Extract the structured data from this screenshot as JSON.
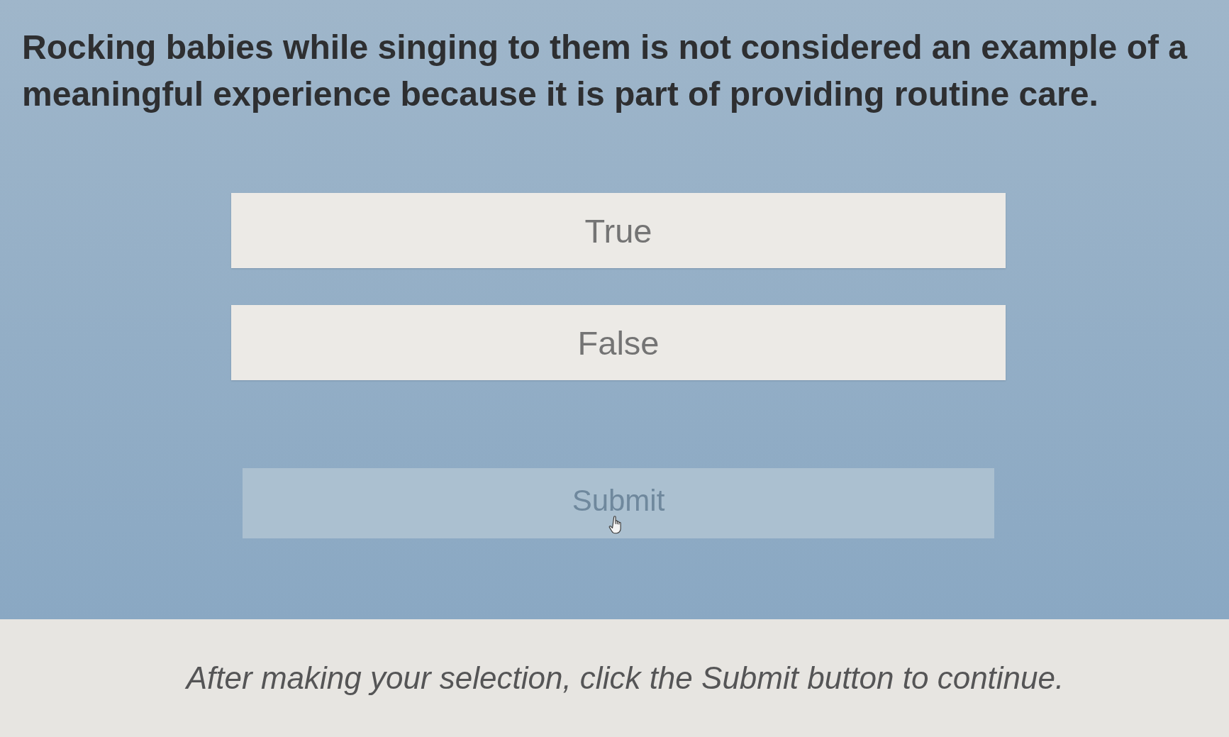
{
  "question": "Rocking babies while singing to them is not considered an example of a meaningful experience because it is part of providing routine care.",
  "options": [
    {
      "label": "True",
      "selected": false
    },
    {
      "label": "False",
      "selected": false
    }
  ],
  "submit": {
    "label": "Submit",
    "disabled": true
  },
  "instruction": "After making your selection, click the Submit button to continue."
}
